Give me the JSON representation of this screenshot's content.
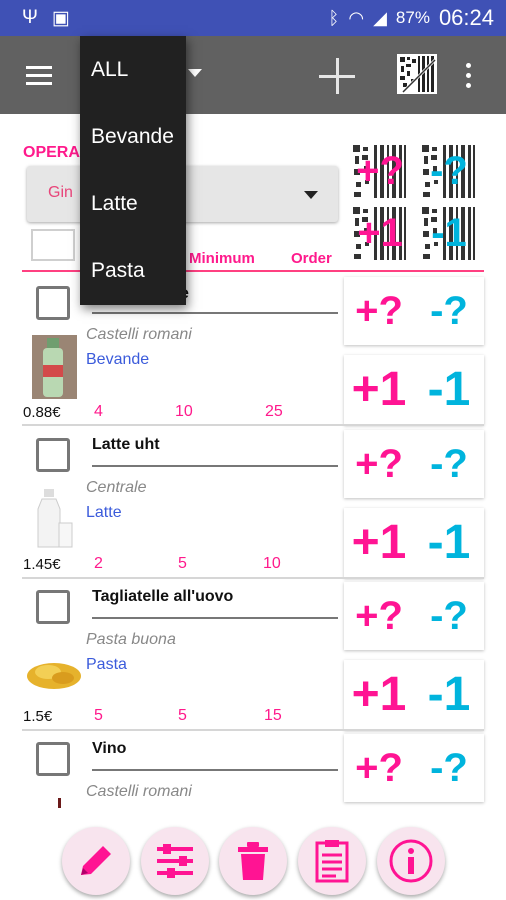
{
  "status_bar": {
    "icons_left": [
      "usb-icon",
      "image-icon"
    ],
    "icons_right": [
      "bluetooth-icon",
      "wifi-icon",
      "signal-icon"
    ],
    "battery": "87%",
    "time": "06:24",
    "color": "#3f51b5"
  },
  "toolbar": {
    "color": "#616161",
    "icons": [
      "menu-icon",
      "dropdown-arrow-icon",
      "add-icon",
      "barcode-icon",
      "more-icon"
    ]
  },
  "menu": {
    "items": [
      {
        "label": "ALL"
      },
      {
        "label": "Bevande"
      },
      {
        "label": "Latte"
      },
      {
        "label": "Pasta"
      }
    ]
  },
  "operation": {
    "label": "OPERA",
    "spinner_value": "Gin"
  },
  "headers": {
    "minimum": "Minimum",
    "order": "Order"
  },
  "top_buttons": {
    "plus_q": "+?",
    "minus_q": "-?",
    "plus_1": "+1",
    "minus_1": "-1"
  },
  "items": [
    {
      "name": "e",
      "brand": "Castelli romani",
      "category": "Bevande",
      "price": "0.88€",
      "qty": "4",
      "minimum": "10",
      "order": "25",
      "image": "bottle"
    },
    {
      "name": "Latte uht",
      "brand": "Centrale",
      "category": "Latte",
      "price": "1.45€",
      "qty": "2",
      "minimum": "5",
      "order": "10",
      "image": "milk"
    },
    {
      "name": "Tagliatelle all'uovo",
      "brand": "Pasta buona",
      "category": "Pasta",
      "price": "1.5€",
      "qty": "5",
      "minimum": "5",
      "order": "15",
      "image": "pasta"
    },
    {
      "name": "Vino",
      "brand": "Castelli romani",
      "category": "",
      "price": "",
      "qty": "",
      "minimum": "",
      "order": "",
      "image": ""
    }
  ],
  "actions": {
    "plus_q": "+?",
    "minus_q": "-?",
    "plus_1": "+1",
    "minus_1": "-1"
  },
  "bottom_bar": {
    "buttons": [
      "edit-icon",
      "settings-sliders-icon",
      "trash-icon",
      "clipboard-icon",
      "info-icon"
    ]
  },
  "colors": {
    "accent_pink": "#ff1493",
    "accent_cyan": "#00b4dd",
    "category_blue": "#3b5bdb"
  }
}
